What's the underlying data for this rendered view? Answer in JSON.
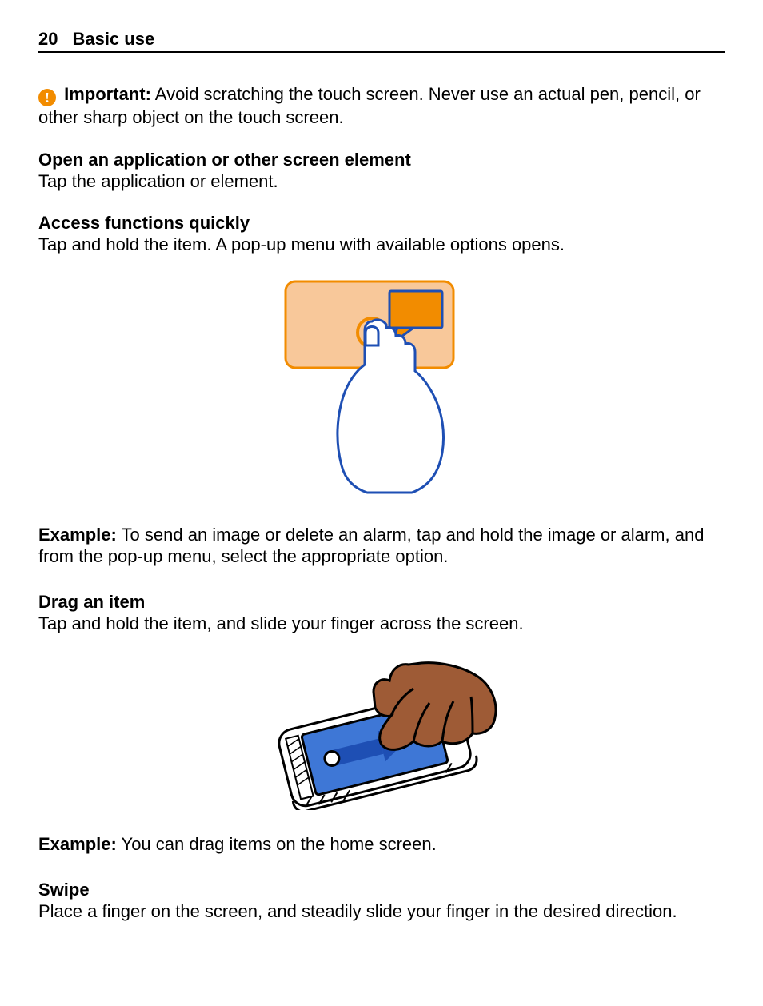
{
  "header": {
    "page_number": "20",
    "section_title": "Basic use"
  },
  "important": {
    "label": "Important:",
    "text": "Avoid scratching the touch screen. Never use an actual pen, pencil, or other sharp object on the touch screen."
  },
  "open_app": {
    "heading": "Open an application or other screen element",
    "text": "Tap the application or element."
  },
  "access_functions": {
    "heading": "Access functions quickly",
    "text": "Tap and hold the item. A pop-up menu with available options opens."
  },
  "example1": {
    "label": "Example:",
    "text": "To send an image or delete an alarm, tap and hold the image or alarm, and from the pop-up menu, select the appropriate option."
  },
  "drag": {
    "heading": "Drag an item",
    "text": "Tap and hold the item, and slide your finger across the screen."
  },
  "example2": {
    "label": "Example:",
    "text": "You can drag items on the home screen."
  },
  "swipe": {
    "heading": "Swipe",
    "text": "Place a finger on the screen, and steadily slide your finger in the desired direction."
  },
  "colors": {
    "accent": "#f28c00",
    "accent_light": "#f8c89a",
    "blue": "#1e4fb4",
    "blue_light": "#3e77d6",
    "skin": "#9e5b36"
  }
}
